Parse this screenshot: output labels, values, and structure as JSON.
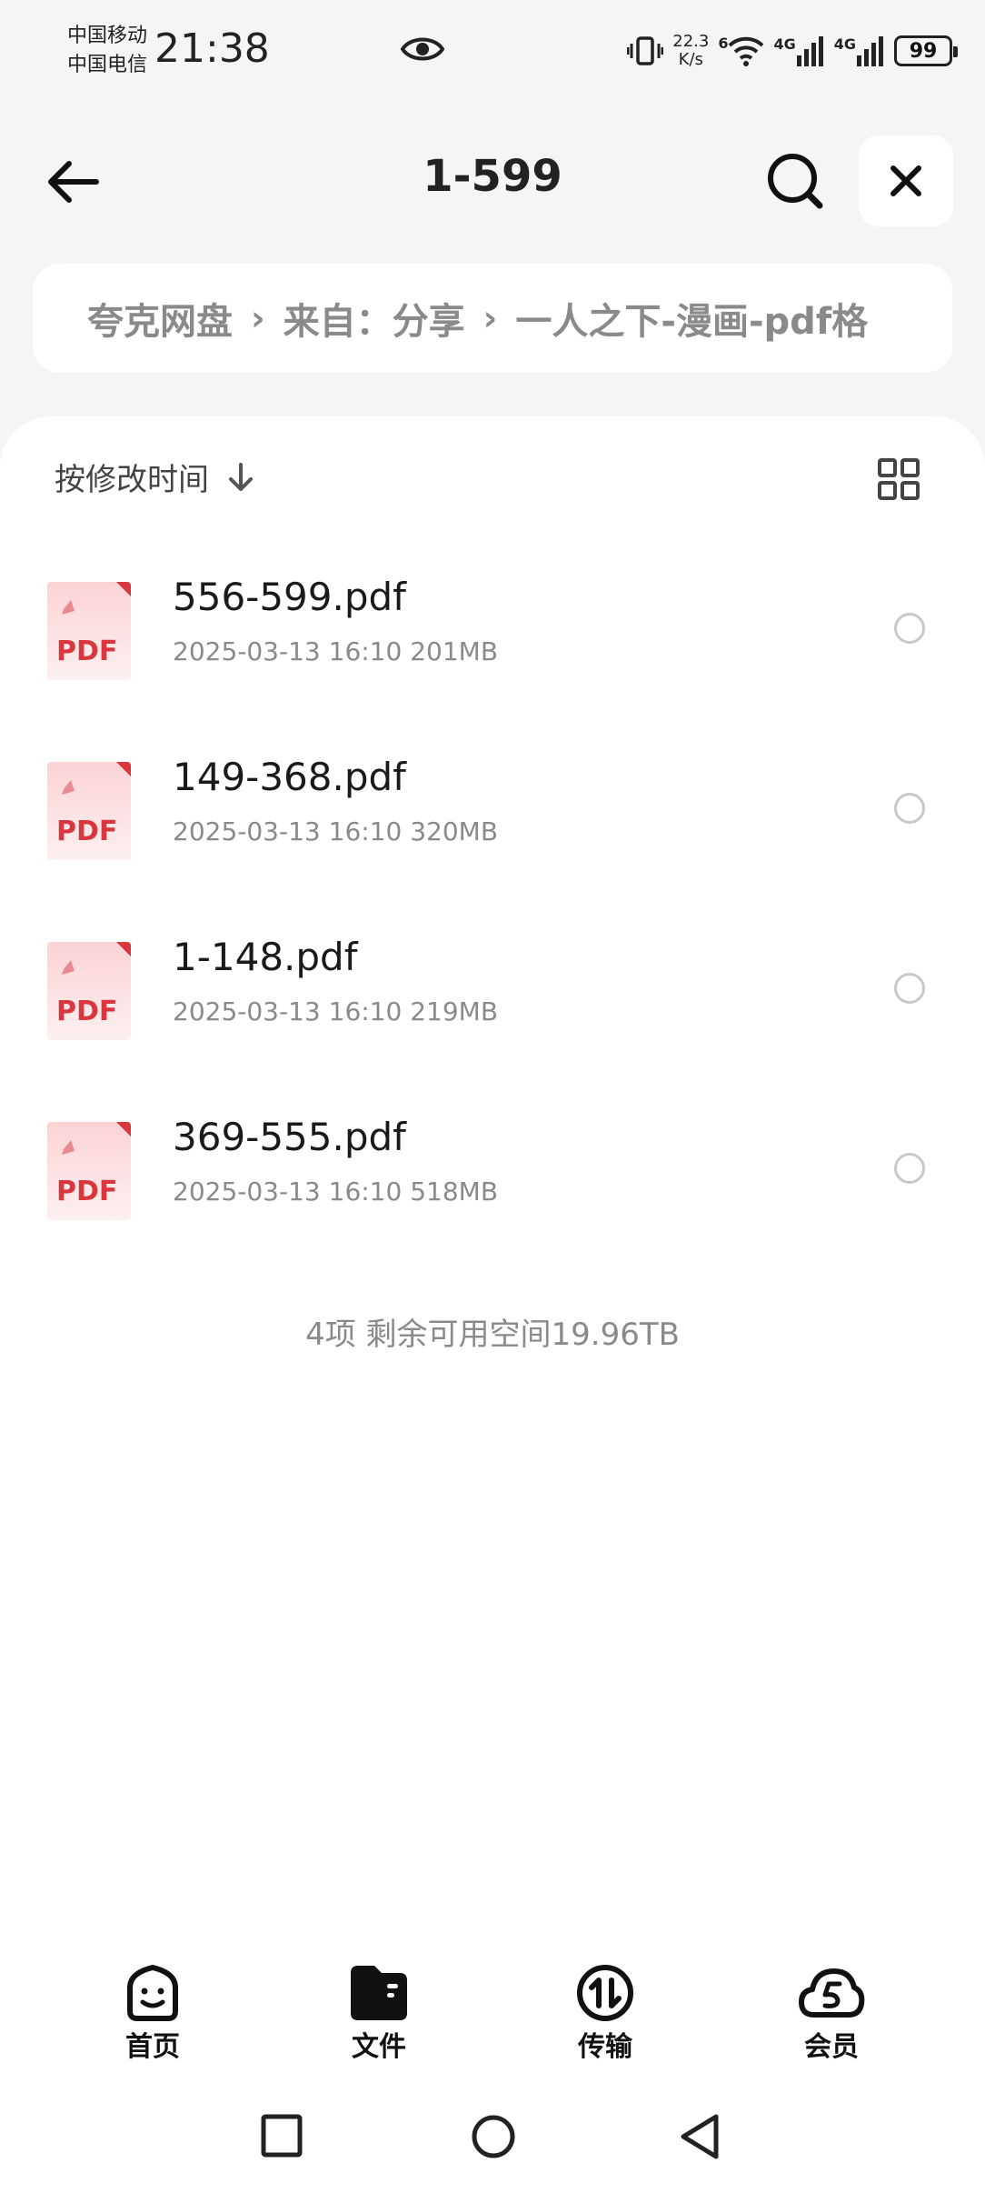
{
  "status_bar": {
    "carrier_1": "中国移动",
    "carrier_2": "中国电信",
    "time": "21:38",
    "speed_value": "22.3",
    "speed_unit": "K/s",
    "wifi_badge": "6",
    "net_1": "4G",
    "net_2": "4G",
    "battery": "99"
  },
  "header": {
    "title": "1-599"
  },
  "breadcrumb": {
    "items": [
      "夸克网盘",
      "来自：分享",
      "一人之下-漫画-pdf格"
    ]
  },
  "toolbar": {
    "sort_label": "按修改时间"
  },
  "files": [
    {
      "name": "556-599.pdf",
      "meta": "2025-03-13 16:10  201MB",
      "icon_text": "PDF"
    },
    {
      "name": "149-368.pdf",
      "meta": "2025-03-13 16:10  320MB",
      "icon_text": "PDF"
    },
    {
      "name": "1-148.pdf",
      "meta": "2025-03-13 16:10  219MB",
      "icon_text": "PDF"
    },
    {
      "name": "369-555.pdf",
      "meta": "2025-03-13 16:10  518MB",
      "icon_text": "PDF"
    }
  ],
  "summary": "4项 剩余可用空间19.96TB",
  "bottom_nav": {
    "items": [
      {
        "label": "首页",
        "icon": "smile-home-icon"
      },
      {
        "label": "文件",
        "icon": "folder-icon"
      },
      {
        "label": "传输",
        "icon": "transfer-icon"
      },
      {
        "label": "会员",
        "icon": "cloud-member-icon"
      }
    ],
    "active_index": 1
  },
  "colors": {
    "pdf_red": "#d9363e",
    "accent_text": "#111111",
    "muted": "#8a8a8a"
  }
}
